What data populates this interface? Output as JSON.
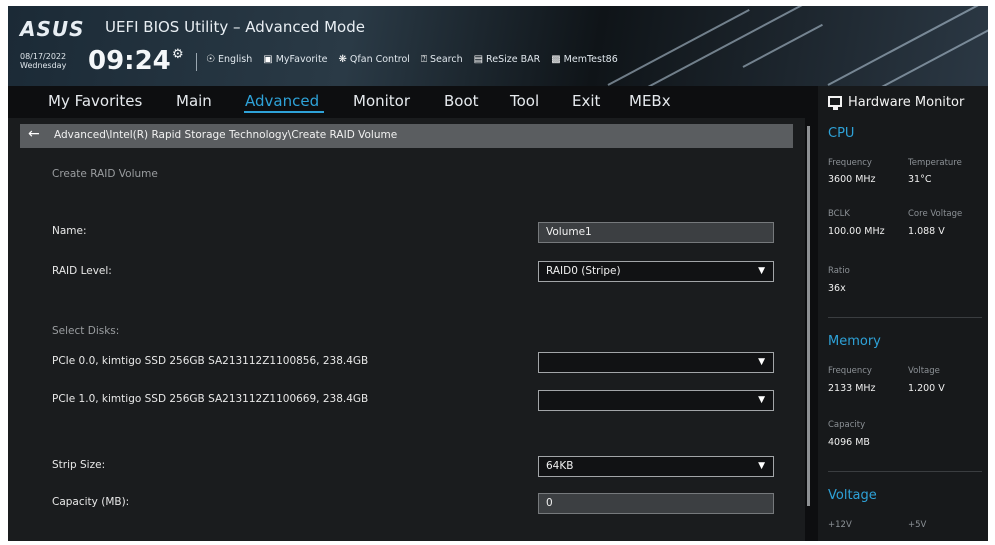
{
  "header": {
    "logo": "ASUS",
    "title": "UEFI BIOS Utility – Advanced Mode",
    "date": "08/17/2022",
    "day": "Wednesday",
    "time": "09:24",
    "toolbar": [
      {
        "label": "English",
        "icon": "globe-icon"
      },
      {
        "label": "MyFavorite",
        "icon": "favorite-icon"
      },
      {
        "label": "Qfan Control",
        "icon": "fan-icon"
      },
      {
        "label": "Search",
        "icon": "search-icon"
      },
      {
        "label": "ReSize BAR",
        "icon": "resize-bar-icon"
      },
      {
        "label": "MemTest86",
        "icon": "memtest-icon"
      }
    ]
  },
  "tabs": [
    "My Favorites",
    "Main",
    "Advanced",
    "Monitor",
    "Boot",
    "Tool",
    "Exit",
    "MEBx"
  ],
  "active_tab": "Advanced",
  "breadcrumb": "Advanced\\Intel(R) Rapid Storage Technology\\Create RAID Volume",
  "form": {
    "section_title": "Create RAID Volume",
    "name_label": "Name:",
    "name_value": "Volume1",
    "raid_level_label": "RAID Level:",
    "raid_level_value": "RAID0 (Stripe)",
    "select_disks_label": "Select Disks:",
    "disk1_label": "PCIe 0.0, kimtigo SSD 256GB SA213112Z1100856, 238.4GB",
    "disk1_value": "",
    "disk2_label": "PCIe 1.0, kimtigo SSD 256GB SA213112Z1100669, 238.4GB",
    "disk2_value": "",
    "strip_size_label": "Strip Size:",
    "strip_size_value": "64KB",
    "capacity_label": "Capacity (MB):",
    "capacity_value": "0"
  },
  "hardware_monitor": {
    "title": "Hardware Monitor",
    "cpu": {
      "heading": "CPU",
      "frequency_label": "Frequency",
      "frequency_value": "3600 MHz",
      "temperature_label": "Temperature",
      "temperature_value": "31°C",
      "bclk_label": "BCLK",
      "bclk_value": "100.00 MHz",
      "core_voltage_label": "Core Voltage",
      "core_voltage_value": "1.088 V",
      "ratio_label": "Ratio",
      "ratio_value": "36x"
    },
    "memory": {
      "heading": "Memory",
      "frequency_label": "Frequency",
      "frequency_value": "2133 MHz",
      "voltage_label": "Voltage",
      "voltage_value": "1.200 V",
      "capacity_label": "Capacity",
      "capacity_value": "4096 MB"
    },
    "voltage": {
      "heading": "Voltage",
      "v12_label": "+12V",
      "v5_label": "+5V"
    }
  },
  "colors": {
    "accent": "#2ea2d8",
    "panel_bg": "#1a1c1e",
    "breadcrumb_bg": "#5a5d60"
  }
}
